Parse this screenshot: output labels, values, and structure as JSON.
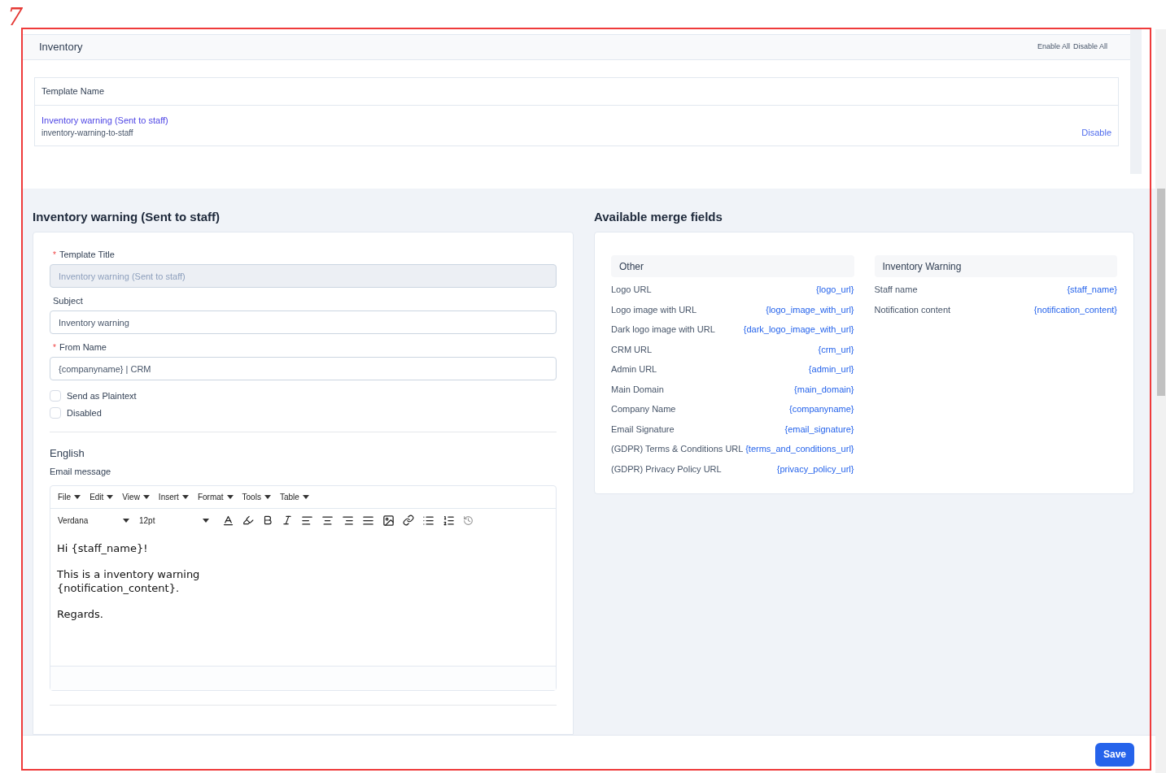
{
  "annotation": {
    "label": "7"
  },
  "section": {
    "title": "Inventory",
    "actions": [
      "Enable All",
      "Disable All"
    ]
  },
  "templates_table": {
    "columns": [
      "Template Name"
    ],
    "rows": [
      {
        "name": "Inventory warning (Sent to staff)",
        "slug": "inventory-warning-to-staff",
        "action": "Disable"
      }
    ]
  },
  "editor_title": "Inventory warning (Sent to staff)",
  "form": {
    "required_mark": "*",
    "fields": [
      {
        "label": "Template Title",
        "required": true,
        "disabled": true,
        "value": "Inventory warning (Sent to staff)"
      },
      {
        "label": "Subject",
        "required": false,
        "disabled": false,
        "value": "Inventory warning"
      },
      {
        "label": "From Name",
        "required": true,
        "disabled": false,
        "value": "{companyname} | CRM"
      }
    ],
    "checkboxes": [
      {
        "label": "Send as Plaintext",
        "checked": false
      },
      {
        "label": "Disabled",
        "checked": false
      }
    ],
    "language": "English",
    "message_label": "Email message",
    "menu": [
      "File",
      "Edit",
      "View",
      "Insert",
      "Format",
      "Tools",
      "Table"
    ],
    "font": "Verdana",
    "size": "12pt",
    "body": [
      "Hi {staff_name}!",
      "This is a inventory warning\n{notification_content}.",
      "Regards."
    ]
  },
  "merge_title": "Available merge fields",
  "merge_groups": [
    {
      "title": "Other",
      "fields": [
        {
          "label": "Logo URL",
          "value": "{logo_url}"
        },
        {
          "label": "Logo image with URL",
          "value": "{logo_image_with_url}"
        },
        {
          "label": "Dark logo image with URL",
          "value": "{dark_logo_image_with_url}"
        },
        {
          "label": "CRM URL",
          "value": "{crm_url}"
        },
        {
          "label": "Admin URL",
          "value": "{admin_url}"
        },
        {
          "label": "Main Domain",
          "value": "{main_domain}"
        },
        {
          "label": "Company Name",
          "value": "{companyname}"
        },
        {
          "label": "Email Signature",
          "value": "{email_signature}"
        },
        {
          "label": "(GDPR) Terms & Conditions URL",
          "value": "{terms_and_conditions_url}"
        },
        {
          "label": "(GDPR) Privacy Policy URL",
          "value": "{privacy_policy_url}"
        }
      ]
    },
    {
      "title": "Inventory Warning",
      "fields": [
        {
          "label": "Staff name",
          "value": "{staff_name}"
        },
        {
          "label": "Notification content",
          "value": "{notification_content}"
        }
      ]
    }
  ],
  "footer": {
    "button": "Save"
  }
}
